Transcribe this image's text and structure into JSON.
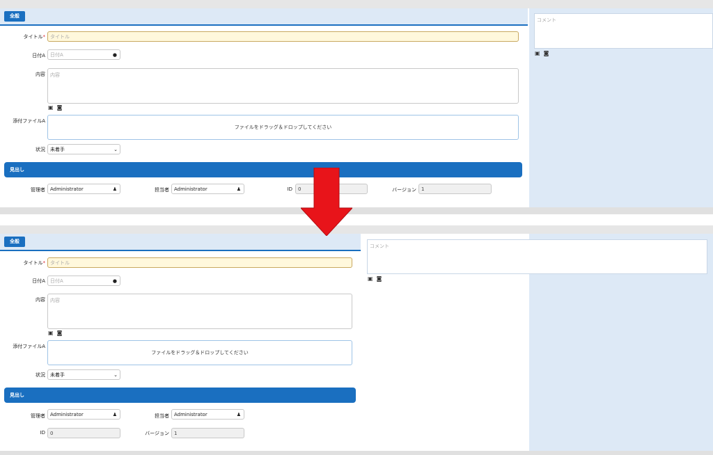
{
  "tab_label": "全般",
  "fields": {
    "title_label": "タイトル",
    "title_required": "*",
    "title_placeholder": "タイトル",
    "date_label": "日付A",
    "date_placeholder": "日付A",
    "content_label": "内容",
    "content_placeholder": "内容",
    "attach_label": "添付ファイルA",
    "attach_drop_text": "ファイルをドラッグ＆ドロップしてください",
    "status_label": "状況",
    "status_value": "未着手"
  },
  "heading_label": "見出し",
  "info": {
    "manager_label": "管理者",
    "manager_value": "Administrator",
    "assignee_label": "担当者",
    "assignee_value": "Administrator",
    "id_label": "ID",
    "id_value": "0",
    "version_label": "バージョン",
    "version_value": "1"
  },
  "comment_placeholder": "コメント",
  "icons": {
    "clock": "clock-icon",
    "user": "user-icon",
    "image": "image-icon",
    "camera": "camera-icon",
    "chevron": "chevron-down-icon",
    "arrow": "down-arrow"
  },
  "colors": {
    "accent": "#1a6fc0",
    "tab_bg": "#dde9f6",
    "side_bg": "#dde9f6",
    "title_bg": "#fff8dc",
    "arrow": "#e8141a"
  }
}
